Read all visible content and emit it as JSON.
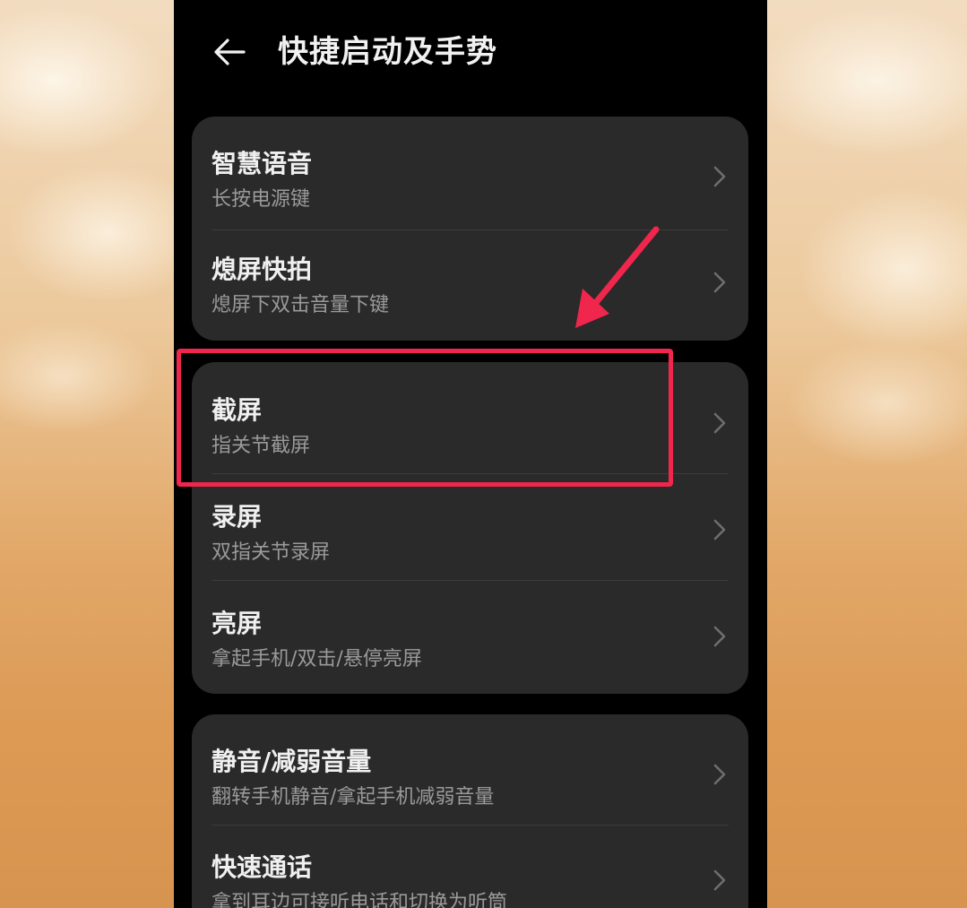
{
  "header": {
    "title": "快捷启动及手势",
    "back_icon": "arrow-left-icon"
  },
  "groups": [
    {
      "items": [
        {
          "title": "智慧语音",
          "subtitle": "长按电源键"
        },
        {
          "title": "熄屏快拍",
          "subtitle": "熄屏下双击音量下键"
        }
      ]
    },
    {
      "items": [
        {
          "title": "截屏",
          "subtitle": "指关节截屏"
        },
        {
          "title": "录屏",
          "subtitle": "双指关节录屏"
        },
        {
          "title": "亮屏",
          "subtitle": "拿起手机/双击/悬停亮屏"
        }
      ]
    },
    {
      "items": [
        {
          "title": "静音/减弱音量",
          "subtitle": "翻转手机静音/拿起手机减弱音量"
        },
        {
          "title": "快速通话",
          "subtitle": "拿到耳边可接听电话和切换为听筒"
        }
      ]
    }
  ],
  "annotation": {
    "color": "#f0264d",
    "highlighted_item": "截屏",
    "arrow_icon": "red-arrow-icon"
  },
  "colors": {
    "screen_bg": "#000000",
    "card_bg": "#2a2a2a",
    "title_text": "#f0f0f0",
    "subtitle_text": "#9a9a9a"
  }
}
